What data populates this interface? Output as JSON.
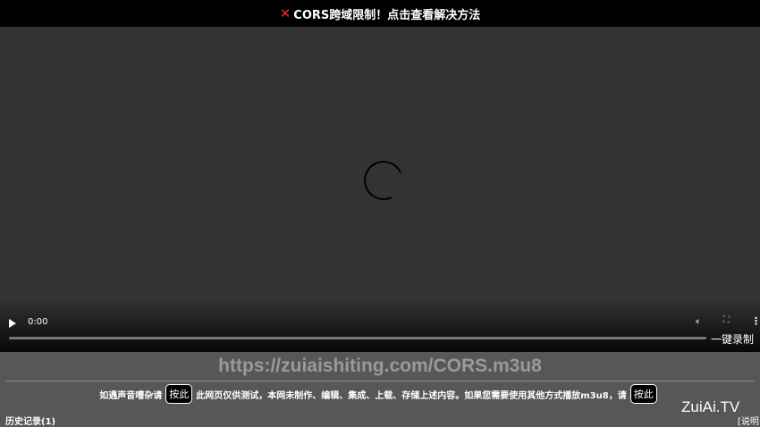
{
  "banner": {
    "icon": "close-icon",
    "text": "CORS跨域限制！点击查看解决方法"
  },
  "player": {
    "time": "0:00",
    "record_label": "一键录制"
  },
  "url": "https://zuiaishiting.com/CORS.m3u8",
  "notice": {
    "prefix": "如遇声音嘈杂请",
    "button1": "按此",
    "middle": "此网页仅供测试，本网未制作、编辑、集成、上载、存储上述内容。如果您需要使用其他方式播放m3u8，请",
    "button2": "按此"
  },
  "history_label": "历史记录(1)",
  "brand": "ZuiAi.TV",
  "help_label": "[说明"
}
